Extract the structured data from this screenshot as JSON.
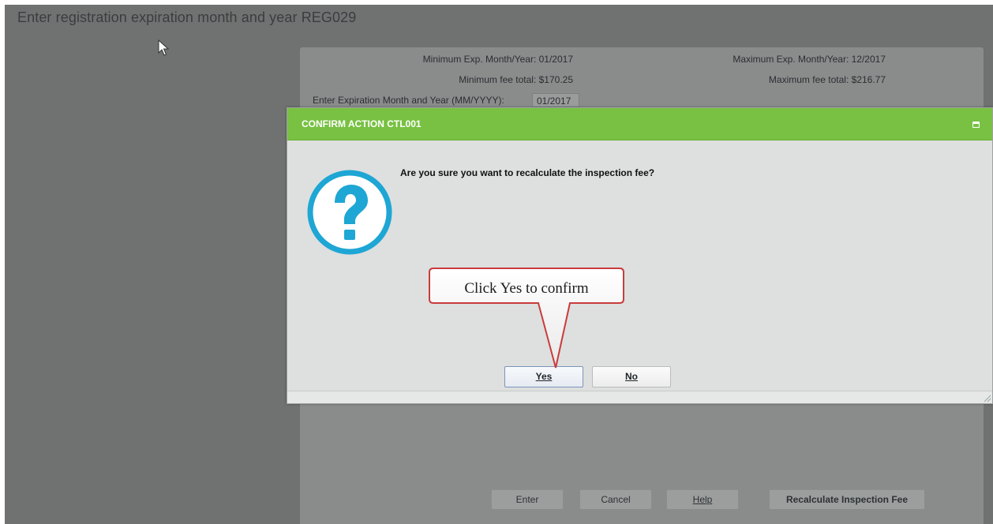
{
  "page": {
    "title": "Enter registration expiration month and year REG029"
  },
  "panel": {
    "min_exp_label": "Minimum Exp. Month/Year: 01/2017",
    "max_exp_label": "Maximum Exp. Month/Year: 12/2017",
    "min_fee_label": "Minimum fee total: $170.25",
    "max_fee_label": "Maximum fee total: $216.77",
    "exp_input_label": "Enter Expiration Month and Year (MM/YYYY):",
    "exp_input_value": "01/2017",
    "buttons": {
      "enter": "Enter",
      "cancel": "Cancel",
      "help": "Help",
      "recalculate": "Recalculate Inspection Fee"
    }
  },
  "dialog": {
    "title": "CONFIRM ACTION CTL001",
    "message": "Are you sure you want to recalculate the inspection fee?",
    "icon": "question-icon",
    "yes_label": "Yes",
    "no_label": "No"
  },
  "callout": {
    "text": "Click Yes to confirm"
  },
  "colors": {
    "header_green": "#78c142",
    "question_blue": "#1ea6d4",
    "callout_border": "#c93c3c",
    "overlay_gray": "#707272"
  }
}
